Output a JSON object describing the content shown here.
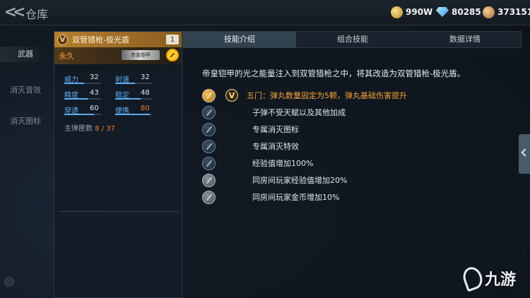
{
  "top_bar": {
    "title": "仓库",
    "gold": "990W",
    "diamonds": "80285",
    "coins": "373151"
  },
  "left_nav": {
    "items": [
      {
        "label": "武器"
      },
      {
        "label": "消灭音效"
      },
      {
        "label": "消灭图标"
      }
    ]
  },
  "weapon": {
    "name": "双管猎枪-极光盾",
    "count": "1",
    "duration": "永久",
    "thumb_label": "赤金铠甲",
    "stats": [
      {
        "label": "威力",
        "value": "32",
        "level": 0.53
      },
      {
        "label": "射速",
        "value": "32",
        "level": 0.53
      },
      {
        "label": "精度",
        "value": "43",
        "level": 0.65
      },
      {
        "label": "稳定",
        "value": "48",
        "level": 0.7
      },
      {
        "label": "穿透",
        "value": "60",
        "level": 0.8
      },
      {
        "label": "便携",
        "value": "80",
        "level": 0.95
      }
    ],
    "ammo_label": "主弹匣数",
    "ammo_value": "8 / 37"
  },
  "tabs": [
    {
      "label": "技能介绍",
      "active": true
    },
    {
      "label": "组合技能",
      "active": false
    },
    {
      "label": "数据详情",
      "active": false
    }
  ],
  "content": {
    "description": "帝皇铠甲的光之能量注入到双管猎枪之中，将其改造为双管猎枪-极光盾。",
    "features": [
      {
        "icon": "shotgun-shell-icon",
        "badge": "V",
        "text": "五门：弹丸数量固定为5颗，弹丸基础伤害提升",
        "highlight": true
      },
      {
        "icon": "bullet-icon",
        "text": "子弹不受天赋以及其他加成"
      },
      {
        "icon": "kill-icon-icon",
        "text": "专属消灭图标"
      },
      {
        "icon": "kill-effect-icon",
        "text": "专属消灭特效"
      },
      {
        "icon": "exp-icon",
        "text": "经验值增加100%"
      },
      {
        "icon": "room-exp-icon",
        "text": "同房间玩家经验值增加20%"
      },
      {
        "icon": "room-coin-icon",
        "text": "同房间玩家金币增加10%"
      }
    ]
  },
  "watermark": {
    "brand": "九游"
  },
  "colors": {
    "accent_blue": "#5aaaf0",
    "accent_orange": "#f07e2f",
    "gold_header": "#b47f2f"
  }
}
